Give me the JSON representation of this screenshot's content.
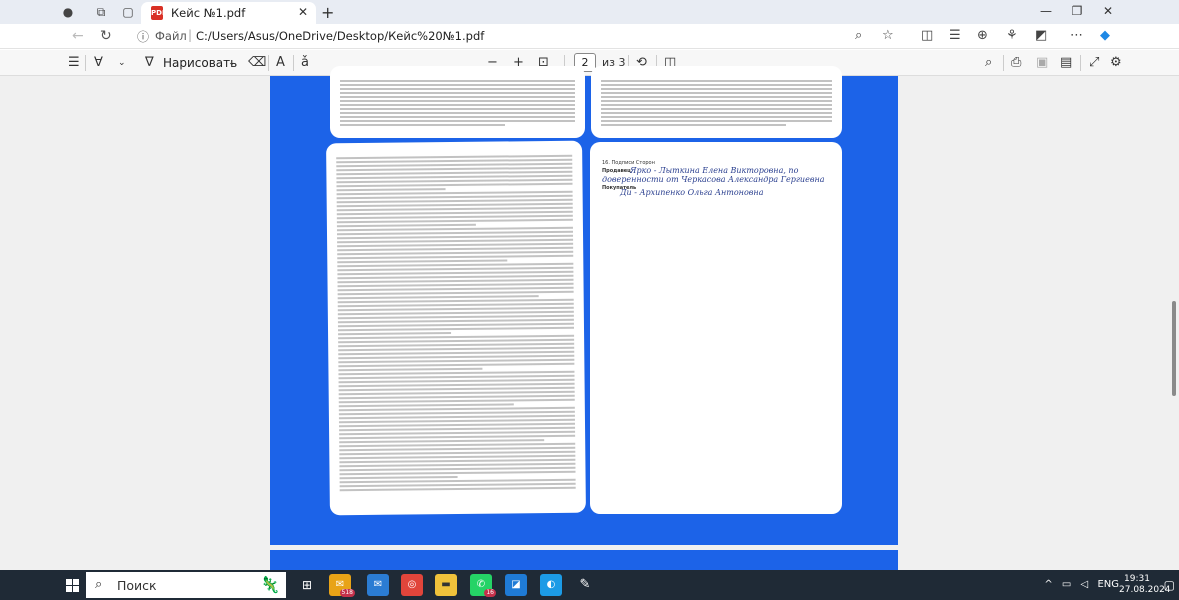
{
  "browser": {
    "tab": {
      "title": "Кейс №1.pdf",
      "icon": "pdf-icon"
    },
    "address": {
      "info_label": "Файл",
      "url": "C:/Users/Asus/OneDrive/Desktop/Кейс%20№1.pdf"
    }
  },
  "pdf_toolbar": {
    "draw_label": "Нарисовать",
    "text_size_label": "A",
    "page_current": "2",
    "page_of": "из 3"
  },
  "document": {
    "signature_page": {
      "heading": "16. Подписи Сторон",
      "seller_label": "Продавец",
      "buyer_label": "Покупатель",
      "seller_sign": "Ярко - Лыткина Елена Викторовна, по",
      "seller_sign_2": "доверенности от Черкасова Александра Гергиевна",
      "buyer_sign": "Ди - Архипенко Ольга Антоновна"
    }
  },
  "taskbar": {
    "search_label": "Поиск",
    "tray_lang": "ENG",
    "time": "19:31",
    "date": "27.08.2024",
    "badge_mail": "518",
    "badge_whatsapp": "16"
  },
  "colors": {
    "pdf_background_blue": "#1c63e8",
    "taskbar": "#1f2a36"
  }
}
